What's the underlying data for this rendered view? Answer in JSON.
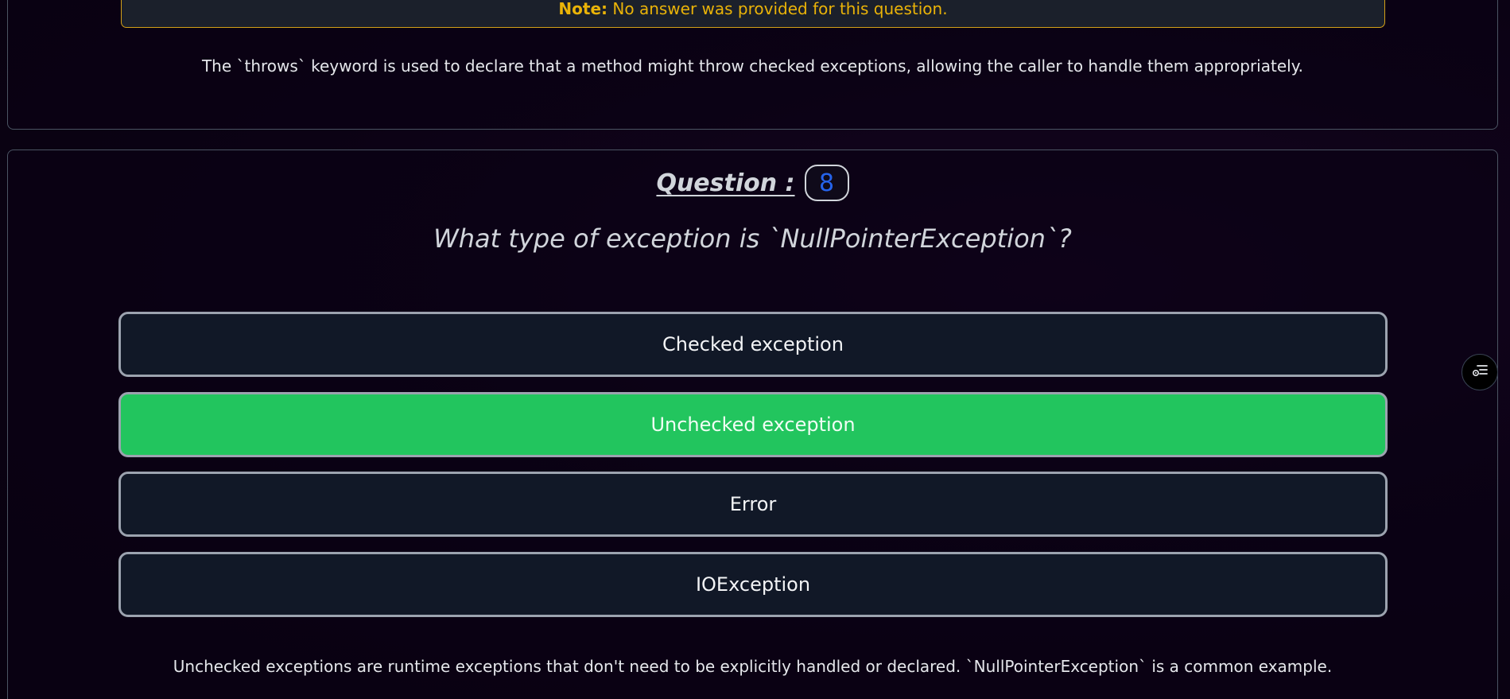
{
  "previous_question": {
    "note_label": "Note:",
    "note_text": " No answer was provided for this question.",
    "explanation": "The `throws` keyword is used to declare that a method might throw checked exceptions, allowing the caller to handle them appropriately."
  },
  "current_question": {
    "label": "Question :",
    "number": "8",
    "text": "What type of exception is `NullPointerException`?",
    "options": [
      {
        "label": "Checked exception",
        "correct": false
      },
      {
        "label": "Unchecked exception",
        "correct": true
      },
      {
        "label": "Error",
        "correct": false
      },
      {
        "label": "IOException",
        "correct": false
      }
    ],
    "explanation": "Unchecked exceptions are runtime exceptions that don't need to be explicitly handled or declared. `NullPointerException` is a common example."
  },
  "floating_button": {
    "icon": "list-settings-icon"
  },
  "colors": {
    "background": "#0b0214",
    "correct_option": "#22c55e",
    "option_bg": "#111827",
    "note_text": "#eab308",
    "question_number": "#2563eb"
  }
}
